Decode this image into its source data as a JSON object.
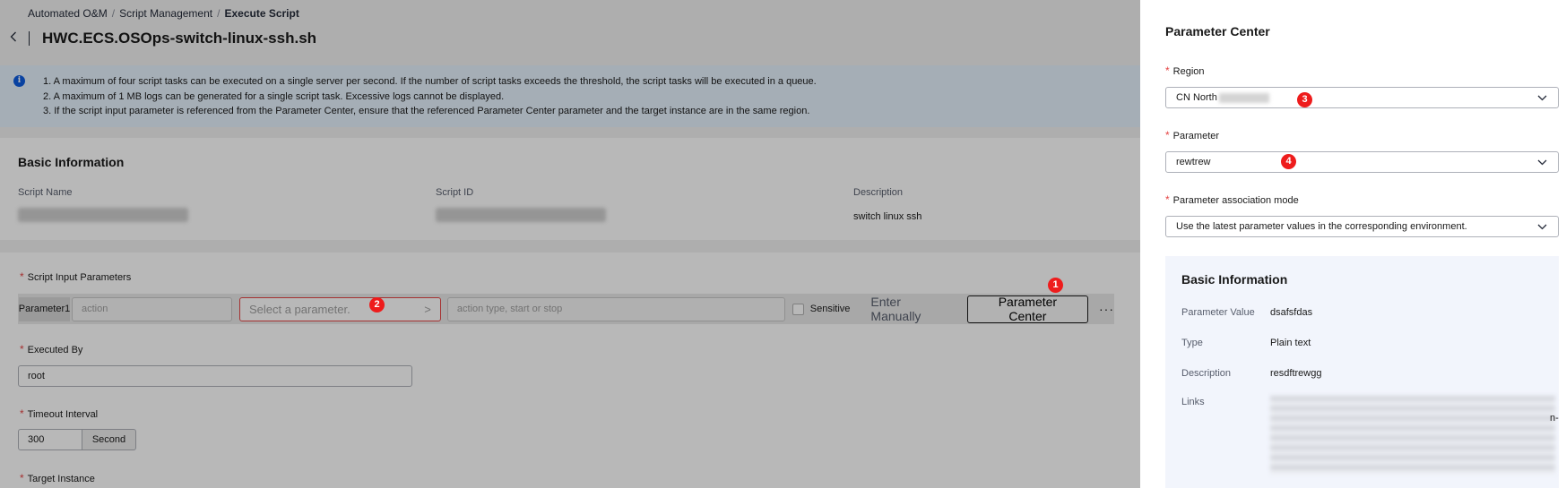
{
  "breadcrumb": {
    "items": [
      "Automated O&M",
      "Script Management"
    ],
    "current": "Execute Script",
    "separator": "/"
  },
  "page": {
    "title": "HWC.ECS.OSOps-switch-linux-ssh.sh",
    "back_icon": "chevron-left-icon"
  },
  "notice": {
    "icon": "info-icon",
    "lines": [
      "1. A maximum of four script tasks can be executed on a single server per second. If the number of script tasks exceeds the threshold, the script tasks will be executed in a queue.",
      "2. A maximum of 1 MB logs can be generated for a single script task. Excessive logs cannot be displayed.",
      "3. If the script input parameter is referenced from the Parameter Center, ensure that the referenced Parameter Center parameter and the target instance are in the same region."
    ]
  },
  "basic_info": {
    "title": "Basic Information",
    "script_name_label": "Script Name",
    "script_id_label": "Script ID",
    "description_label": "Description",
    "description_value": "switch linux ssh"
  },
  "form": {
    "required_mark": "*",
    "input_params_label": "Script Input Parameters",
    "param_tag": "Parameter1",
    "param_name_placeholder": "action",
    "param_select_placeholder": "Select a parameter.",
    "param_select_arrow": ">",
    "param_desc_placeholder": "action type, start or stop",
    "sensitive_label": "Sensitive",
    "enter_manually": "Enter Manually",
    "parameter_center_button": "Parameter Center",
    "more_label": "···",
    "executed_by_label": "Executed By",
    "executed_by_value": "root",
    "timeout_label": "Timeout Interval",
    "timeout_value": "300",
    "timeout_unit": "Second",
    "target_instance_label": "Target Instance"
  },
  "badges": [
    "1",
    "2",
    "3",
    "4"
  ],
  "drawer": {
    "title": "Parameter Center",
    "region_label": "Region",
    "region_value": "CN North",
    "parameter_label": "Parameter",
    "parameter_value": "rewtrew",
    "association_label": "Parameter association mode",
    "association_value": "Use the latest parameter values in the corresponding environment.",
    "chevron_icon": "chevron-down-icon",
    "info": {
      "title": "Basic Information",
      "value_label": "Parameter Value",
      "value": "dsafsfdas",
      "type_label": "Type",
      "type": "Plain text",
      "description_label": "Description",
      "description": "resdftrewgg",
      "links_label": "Links",
      "links_suffix": "n-"
    }
  },
  "colors": {
    "badge": "#ee1c1c",
    "required": "#e54545",
    "notice_bg": "#e5f1fc",
    "info_panel_bg": "#f2f5fc"
  }
}
